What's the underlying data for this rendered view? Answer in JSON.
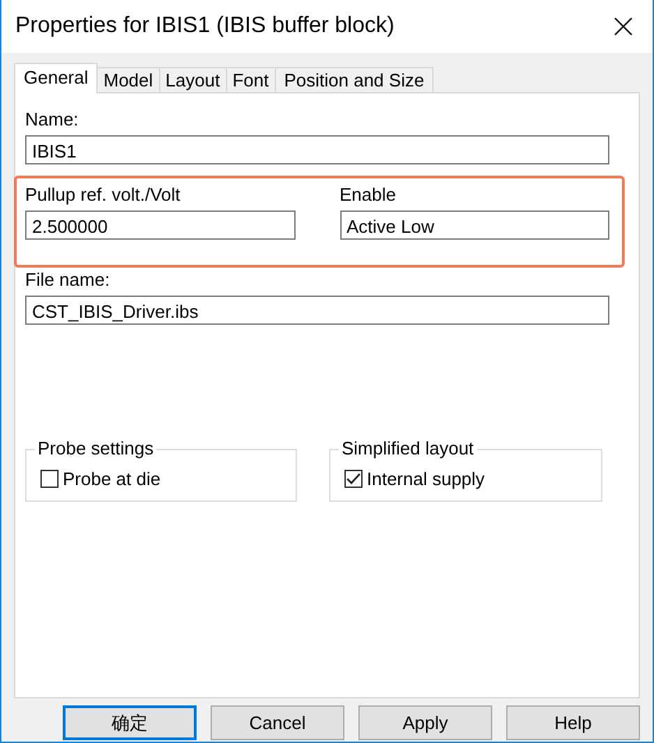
{
  "window": {
    "title": "Properties for IBIS1 (IBIS buffer block)"
  },
  "tabs": [
    {
      "label": "General",
      "selected": true
    },
    {
      "label": "Model",
      "selected": false
    },
    {
      "label": "Layout",
      "selected": false
    },
    {
      "label": "Font",
      "selected": false
    },
    {
      "label": "Position and Size",
      "selected": false
    }
  ],
  "name": {
    "label": "Name:",
    "value": "IBIS1"
  },
  "highlighted_fields": [
    {
      "label": "Pullup ref. volt./Volt",
      "value": "2.500000"
    },
    {
      "label": "Enable",
      "value": "Active Low"
    }
  ],
  "file_name": {
    "label": "File name:",
    "value": "CST_IBIS_Driver.ibs"
  },
  "groups": [
    {
      "title": "Probe settings",
      "checkbox": {
        "label": "Probe at die",
        "checked": false
      }
    },
    {
      "title": "Simplified layout",
      "checkbox": {
        "label": "Internal supply",
        "checked": true
      }
    }
  ],
  "buttons": [
    {
      "label": "确定",
      "default": true
    },
    {
      "label": "Cancel",
      "default": false
    },
    {
      "label": "Apply",
      "default": false
    },
    {
      "label": "Help",
      "default": false
    }
  ]
}
